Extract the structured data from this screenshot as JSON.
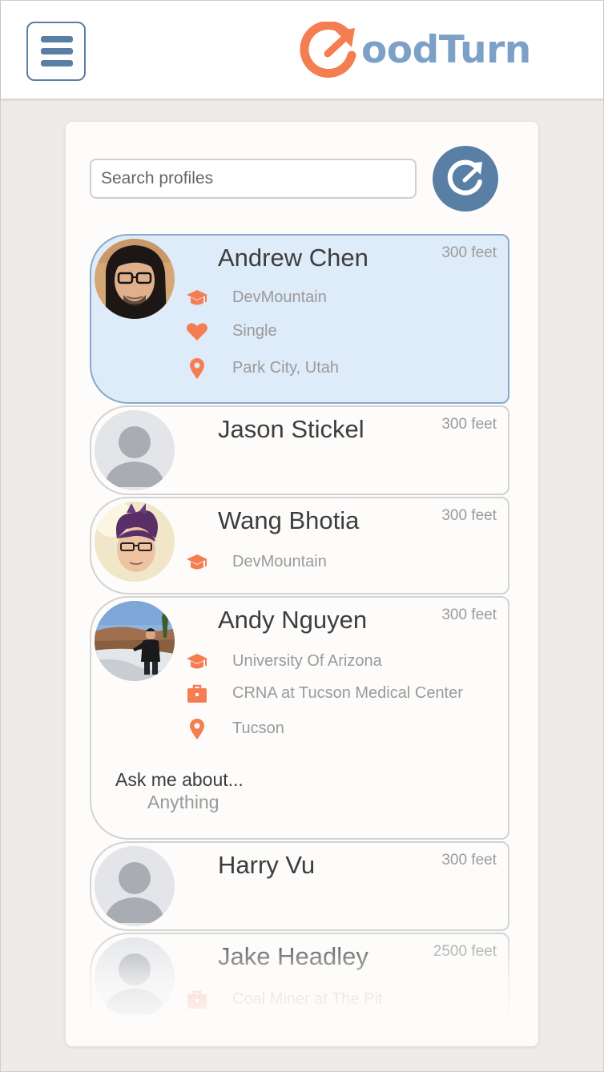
{
  "app": {
    "logo_initial": "G",
    "logo_text": "oodTurn",
    "brand_orange": "#f47d52",
    "brand_blue": "#5a7fa4",
    "brand_light_blue": "#7da1c6"
  },
  "header": {
    "menu_icon": "hamburger-menu-icon"
  },
  "search": {
    "placeholder": "Search profiles",
    "value": ""
  },
  "refresh": {
    "icon": "refresh-icon"
  },
  "profiles": [
    {
      "name": "Andrew Chen",
      "distance": "300 feet",
      "selected": true,
      "details": [
        {
          "icon": "graduation-cap-icon",
          "text": "DevMountain"
        },
        {
          "icon": "heart-icon",
          "text": "Single"
        },
        {
          "icon": "location-pin-icon",
          "text": "Park City, Utah"
        }
      ]
    },
    {
      "name": "Jason Stickel",
      "distance": "300 feet",
      "details": []
    },
    {
      "name": "Wang Bhotia",
      "distance": "300 feet",
      "details": [
        {
          "icon": "graduation-cap-icon",
          "text": "DevMountain"
        }
      ]
    },
    {
      "name": "Andy Nguyen",
      "distance": "300 feet",
      "details": [
        {
          "icon": "graduation-cap-icon",
          "text": "University Of Arizona"
        },
        {
          "icon": "briefcase-icon",
          "text": "CRNA at Tucson Medical Center"
        },
        {
          "icon": "location-pin-icon",
          "text": "Tucson"
        }
      ],
      "ask_label": "Ask me about...",
      "ask_value": "Anything"
    },
    {
      "name": "Harry Vu",
      "distance": "300 feet",
      "details": []
    },
    {
      "name": "Jake Headley",
      "distance": "2500 feet",
      "details": [
        {
          "icon": "briefcase-icon",
          "text": "Coal Miner at The Pit"
        }
      ]
    }
  ]
}
